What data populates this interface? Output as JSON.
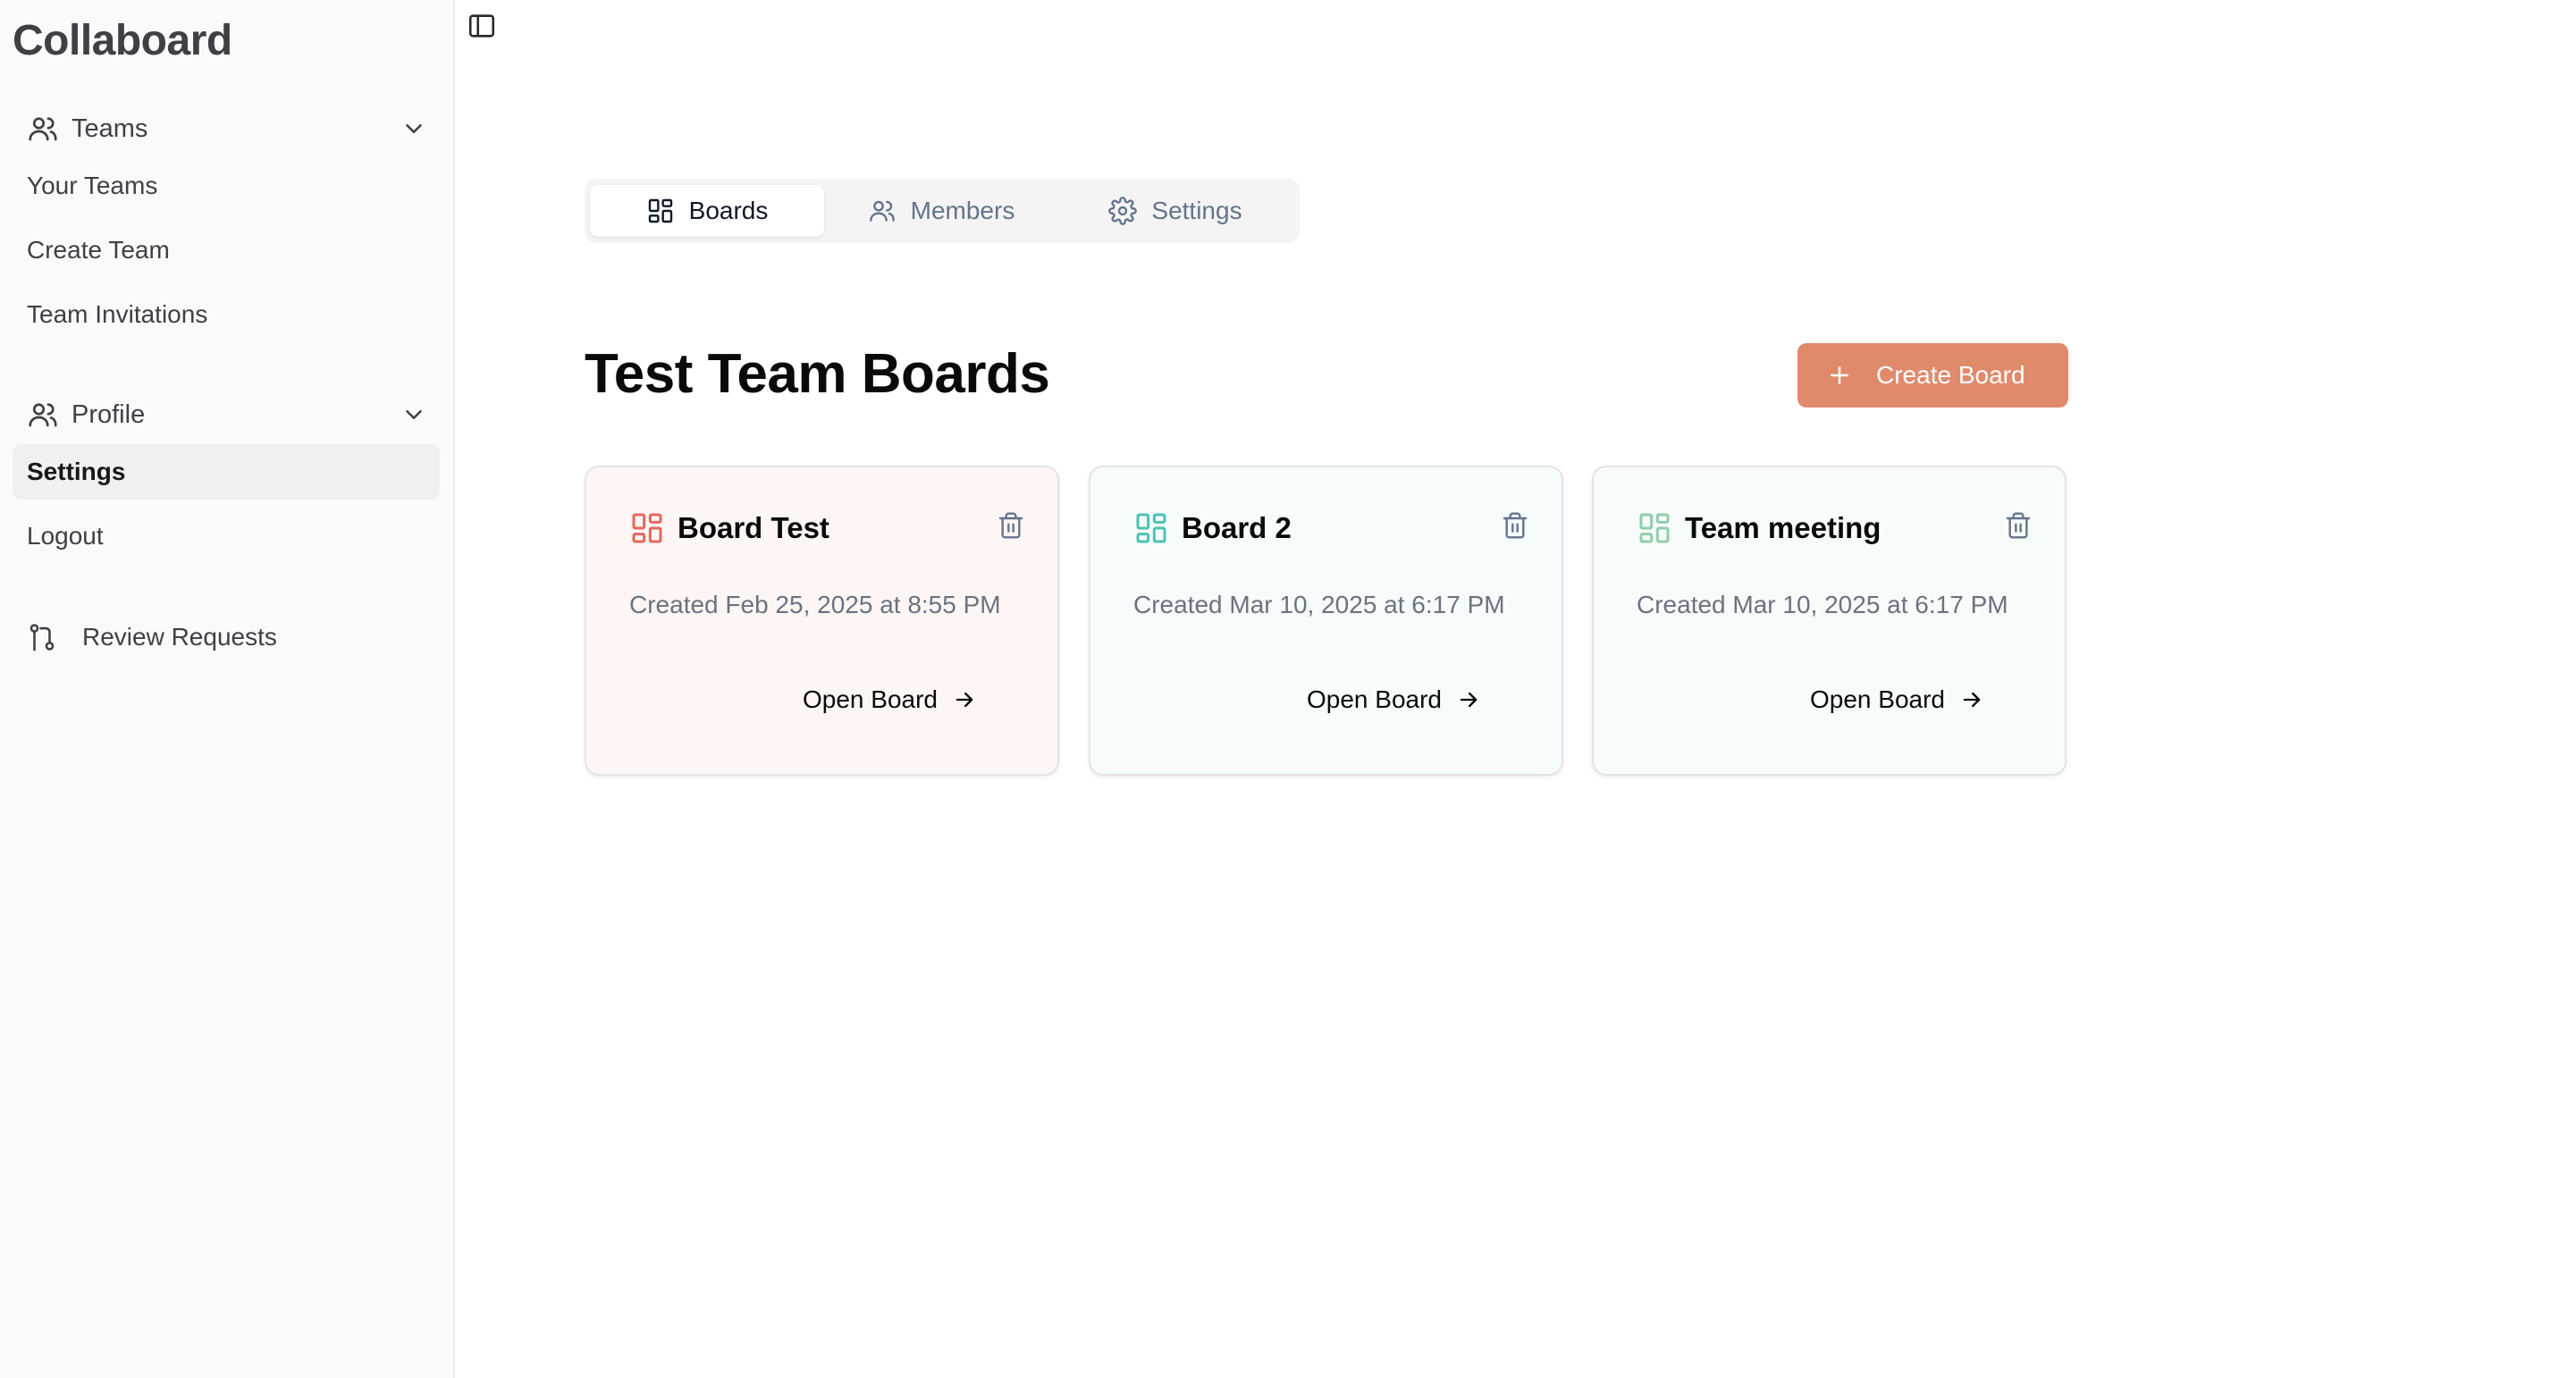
{
  "app": {
    "name": "Collaboard"
  },
  "sidebar": {
    "teams_group": {
      "label": "Teams",
      "items": [
        {
          "label": "Your Teams"
        },
        {
          "label": "Create Team"
        },
        {
          "label": "Team Invitations"
        }
      ]
    },
    "profile_group": {
      "label": "Profile",
      "items": [
        {
          "label": "Settings",
          "active": true
        },
        {
          "label": "Logout"
        }
      ]
    },
    "review_requests": {
      "label": "Review Requests"
    }
  },
  "tabs": [
    {
      "label": "Boards",
      "icon": "layout-grid-icon",
      "active": true
    },
    {
      "label": "Members",
      "icon": "users-icon"
    },
    {
      "label": "Settings",
      "icon": "gear-icon"
    }
  ],
  "main": {
    "title": "Test Team Boards",
    "create_button": "Create Board"
  },
  "boards": [
    {
      "title": "Board Test",
      "created": "Created Feb 25, 2025 at 8:55 PM",
      "open_label": "Open Board",
      "accent": "#e2685c",
      "background": "#fdf6f5"
    },
    {
      "title": "Board 2",
      "created": "Created Mar 10, 2025 at 6:17 PM",
      "open_label": "Open Board",
      "accent": "#4fc1b3",
      "background": "#f6fbfb"
    },
    {
      "title": "Team meeting",
      "created": "Created Mar 10, 2025 at 6:17 PM",
      "open_label": "Open Board",
      "accent": "#8fcfac",
      "background": "#f7fbf9"
    }
  ],
  "colors": {
    "primary_button": "#e08a6c",
    "sidebar_bg": "#fafafa"
  }
}
